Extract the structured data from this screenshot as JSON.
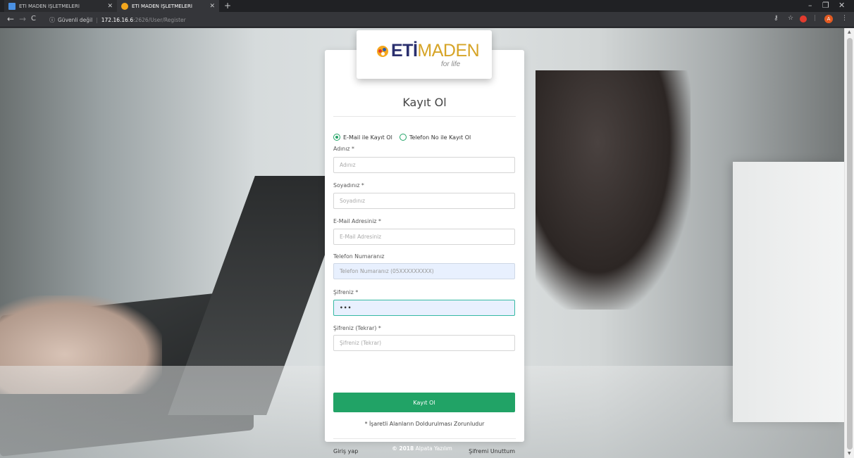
{
  "browser": {
    "tabs": [
      {
        "title": "ETİ MADEN İŞLETMELERİ",
        "active": false
      },
      {
        "title": "ETİ MADEN İŞLETMELERİ",
        "active": true
      }
    ],
    "address": {
      "security_label": "Güvenli değil",
      "host": "172.16.16.6",
      "path": ":2626/User/Register"
    },
    "profile_initial": "A"
  },
  "logo": {
    "eti": "ETİ",
    "maden": "MADEN",
    "tagline": "for life"
  },
  "form": {
    "title": "Kayıt Ol",
    "radio_email": "E-Mail ile Kayıt Ol",
    "radio_phone": "Telefon No ile Kayıt Ol",
    "selected_option": "email",
    "fields": {
      "name": {
        "label": "Adınız *",
        "placeholder": "Adınız"
      },
      "surname": {
        "label": "Soyadınız *",
        "placeholder": "Soyadınız"
      },
      "email": {
        "label": "E-Mail Adresiniz *",
        "placeholder": "E-Mail Adresiniz"
      },
      "phone": {
        "label": "Telefon Numaranız",
        "placeholder": "Telefon Numaranız (05XXXXXXXXX)"
      },
      "password": {
        "label": "Şifreniz *",
        "value": "•••"
      },
      "password_repeat": {
        "label": "Şifreniz (Tekrar) *",
        "placeholder": "Şifreniz (Tekrar)"
      }
    },
    "submit_label": "Kayıt Ol",
    "required_note": "* İşaretli Alanların Doldurulması Zorunludur",
    "login_link": "Giriş yap",
    "forgot_link": "Şifremi Unuttum"
  },
  "footer": {
    "year": "© 2018",
    "company": "Alpata Yazılım"
  },
  "colors": {
    "accent": "#21a366",
    "brand_navy": "#2a2f6e",
    "brand_gold": "#d6a427"
  }
}
